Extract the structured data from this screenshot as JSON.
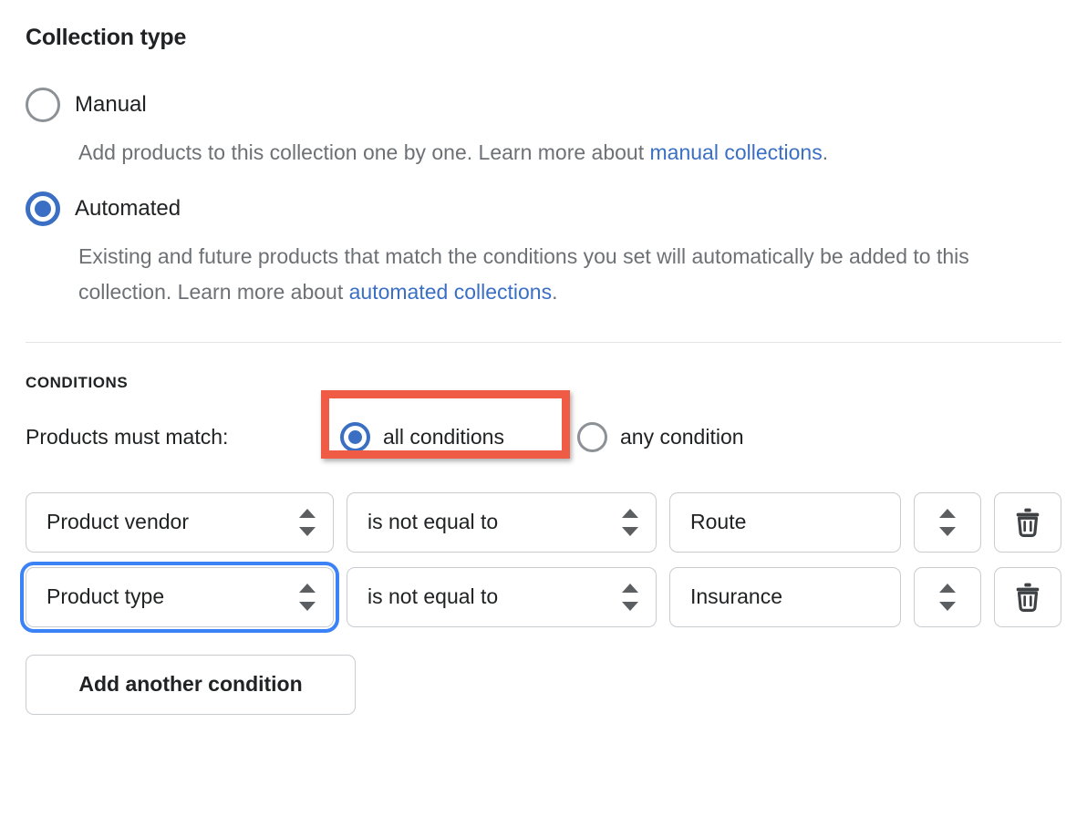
{
  "collection_type": {
    "title": "Collection type",
    "options": [
      {
        "label": "Manual",
        "selected": false,
        "description_before": "Add products to this collection one by one. Learn more about ",
        "link_text": "manual collections",
        "description_after": "."
      },
      {
        "label": "Automated",
        "selected": true,
        "description_before": "Existing and future products that match the conditions you set will automatically be added to this collection. Learn more about ",
        "link_text": "automated collections",
        "description_after": "."
      }
    ]
  },
  "conditions": {
    "heading": "CONDITIONS",
    "match_label": "Products must match:",
    "match_options": [
      {
        "label": "all conditions",
        "selected": true
      },
      {
        "label": "any condition",
        "selected": false
      }
    ],
    "rows": [
      {
        "attribute": "Product vendor",
        "operator": "is not equal to",
        "value": "Route",
        "attribute_icon": "chevron-updown-icon",
        "operator_icon": "chevron-updown-icon",
        "value_stepper_icon": "chevron-updown-icon",
        "delete_icon": "trash-icon",
        "focused": false
      },
      {
        "attribute": "Product type",
        "operator": "is not equal to",
        "value": "Insurance",
        "attribute_icon": "chevron-updown-icon",
        "operator_icon": "chevron-updown-icon",
        "value_stepper_icon": "chevron-updown-icon",
        "delete_icon": "trash-icon",
        "focused": true
      }
    ],
    "add_button_label": "Add another condition"
  },
  "annotation": {
    "type": "highlight-rectangle",
    "target": "all conditions radio option",
    "color": "#ef5b45"
  },
  "colors": {
    "accent_blue": "#3b6fc4",
    "link_blue": "#3b6fc4",
    "focus_blue": "#3b82f6",
    "text": "#202223",
    "muted_text": "#6d7175",
    "border": "#c9cccf",
    "divider": "#e3e4e6",
    "highlight_red": "#ef5b45"
  }
}
